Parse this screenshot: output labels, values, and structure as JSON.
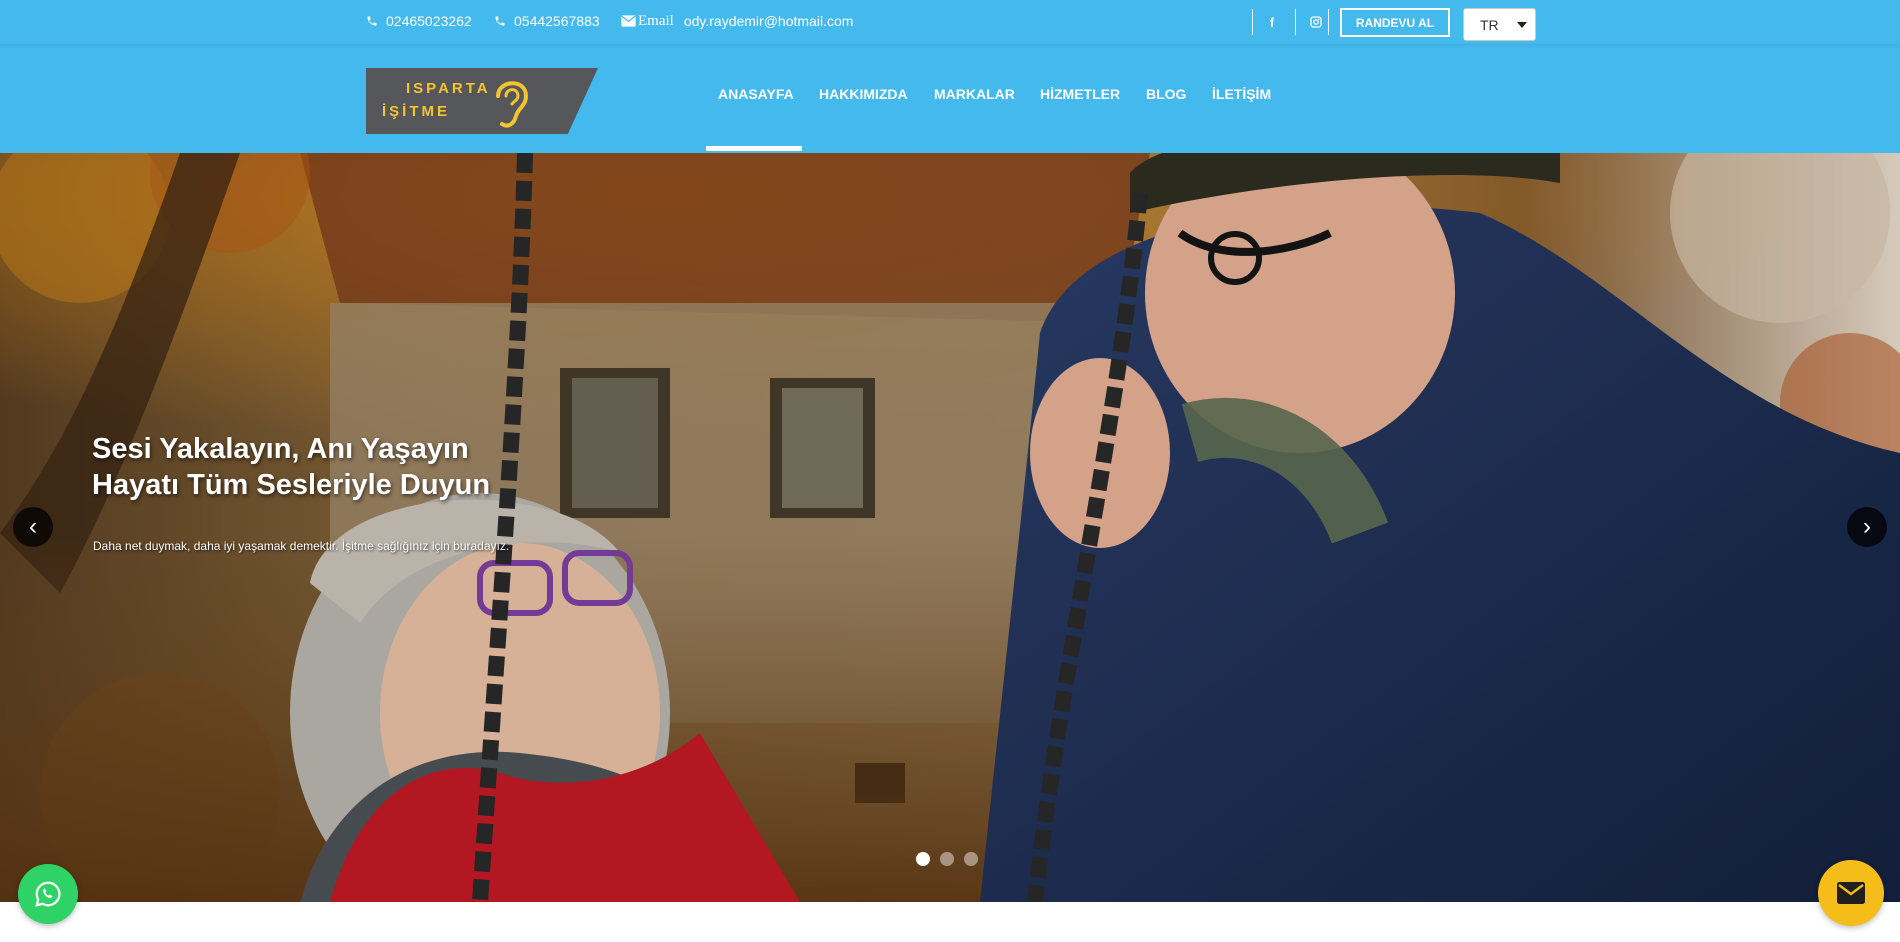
{
  "topbar": {
    "phone1": "02465023262",
    "phone2": "05442567883",
    "email_label": "Email",
    "email": "ody.raydemir@hotmail.com",
    "facebook_icon": "f",
    "instagram_icon": "instagram-icon",
    "appointment_label": "RANDEVU AL",
    "language": "TR"
  },
  "logo": {
    "line1": "ISPARTA",
    "line2": "İŞİTME",
    "color": "#f4c430"
  },
  "nav": {
    "items": [
      {
        "label": "ANASAYFA",
        "active": true
      },
      {
        "label": "HAKKIMIZDA",
        "active": false
      },
      {
        "label": "MARKALAR",
        "active": false
      },
      {
        "label": "HİZMETLER",
        "active": false
      },
      {
        "label": "BLOG",
        "active": false
      },
      {
        "label": "İLETİŞİM",
        "active": false
      }
    ]
  },
  "hero": {
    "title_line1": "Sesi Yakalayın, Anı Yaşayın",
    "title_line2": "Hayatı Tüm Sesleriyle Duyun",
    "subtitle": "Daha net duymak, daha iyi yaşamak demektir. İşitme sağlığınız için buradayız.",
    "prev": "‹",
    "next": "›",
    "slides_count": 3,
    "active_slide": 1
  },
  "colors": {
    "primary": "#44b9ee",
    "whatsapp": "#2fd266",
    "mail_fab": "#f5bd1a"
  }
}
